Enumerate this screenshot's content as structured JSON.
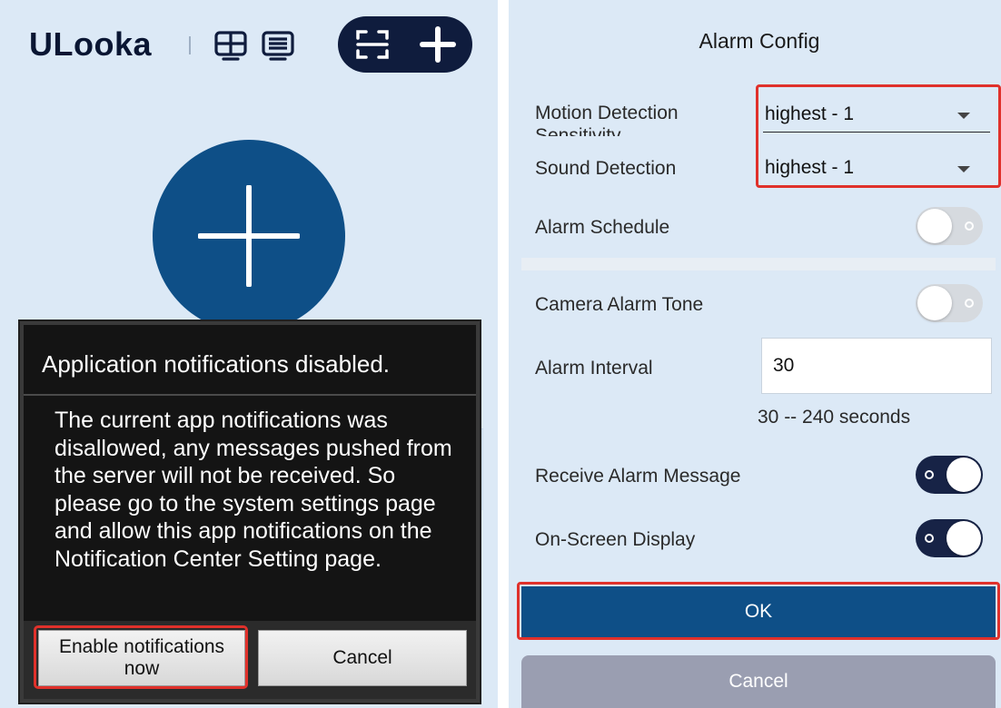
{
  "left": {
    "app_title": "ULooka",
    "header_icons": [
      "grid-view-icon",
      "list-view-icon",
      "scan-icon",
      "plus-icon"
    ],
    "dialog": {
      "title": "Application notifications disabled.",
      "message": "The current app notifications was disallowed, any messages pushed from the server will not be received. So please go to the system settings page and allow this app notifications on the Notification Center Setting page.",
      "enable_label": "Enable notifications now",
      "cancel_label": "Cancel"
    }
  },
  "right": {
    "title": "Alarm Config",
    "motion_label": "Motion Detection Sensitivity",
    "motion_value": "highest - 1",
    "sound_label": "Sound Detection",
    "sound_value": "highest - 1",
    "schedule_label": "Alarm Schedule",
    "schedule_on": false,
    "tone_label": "Camera Alarm Tone",
    "tone_on": false,
    "interval_label": "Alarm Interval",
    "interval_value": "30",
    "interval_hint": "30 -- 240 seconds",
    "receive_label": "Receive Alarm Message",
    "receive_on": true,
    "osd_label": "On-Screen Display",
    "osd_on": true,
    "ok_label": "OK",
    "cancel_label": "Cancel"
  },
  "colors": {
    "background": "#dce9f6",
    "primary": "#0e4f87",
    "dark_navy": "#0f1c3d",
    "highlight_red": "#e0312b",
    "cancel_gray": "#9a9eb1"
  }
}
